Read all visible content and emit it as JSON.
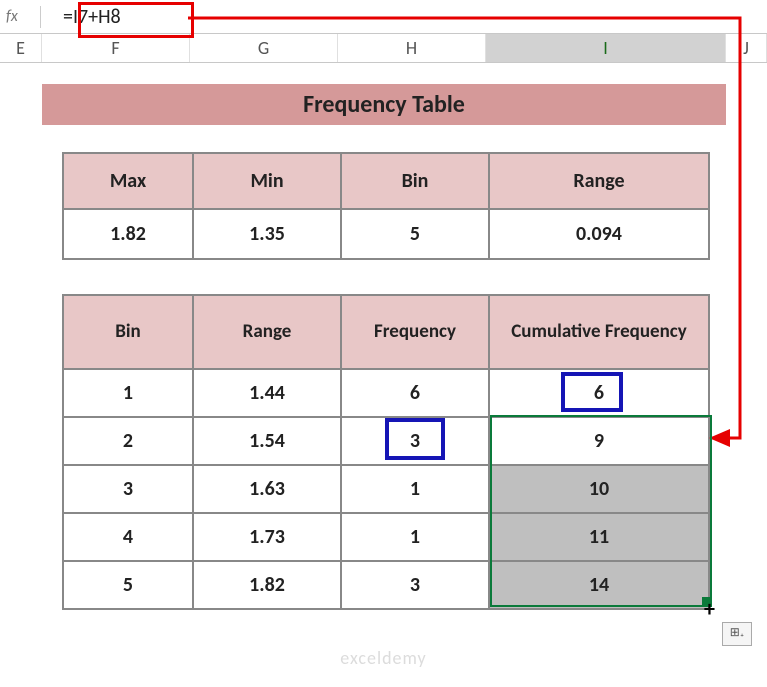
{
  "formula_bar": {
    "fx": "fx",
    "formula": "=I7+H8"
  },
  "columns": {
    "E": "E",
    "F": "F",
    "G": "G",
    "H": "H",
    "I": "I",
    "J": "J"
  },
  "title": "Frequency Table",
  "stats": {
    "headers": {
      "max": "Max",
      "min": "Min",
      "bin": "Bin",
      "range": "Range"
    },
    "values": {
      "max": "1.82",
      "min": "1.35",
      "bin": "5",
      "range": "0.094"
    }
  },
  "main": {
    "headers": {
      "bin": "Bin",
      "range": "Range",
      "freq": "Frequency",
      "cum": "Cumulative Frequency"
    },
    "rows": [
      {
        "bin": "1",
        "range": "1.44",
        "freq": "6",
        "cum": "6"
      },
      {
        "bin": "2",
        "range": "1.54",
        "freq": "3",
        "cum": "9"
      },
      {
        "bin": "3",
        "range": "1.63",
        "freq": "1",
        "cum": "10"
      },
      {
        "bin": "4",
        "range": "1.73",
        "freq": "1",
        "cum": "11"
      },
      {
        "bin": "5",
        "range": "1.82",
        "freq": "3",
        "cum": "14"
      }
    ]
  },
  "autofill_glyph": "⊞₊",
  "fill_cursor": "+",
  "watermark": "exceldemy",
  "chart_data": {
    "type": "table",
    "title": "Frequency Table",
    "summary": {
      "Max": 1.82,
      "Min": 1.35,
      "Bin": 5,
      "Range": 0.094
    },
    "columns": [
      "Bin",
      "Range",
      "Frequency",
      "Cumulative Frequency"
    ],
    "rows": [
      [
        1,
        1.44,
        6,
        6
      ],
      [
        2,
        1.54,
        3,
        9
      ],
      [
        3,
        1.63,
        1,
        10
      ],
      [
        4,
        1.73,
        1,
        11
      ],
      [
        5,
        1.82,
        3,
        14
      ]
    ],
    "active_cell_formula": "=I7+H8"
  }
}
